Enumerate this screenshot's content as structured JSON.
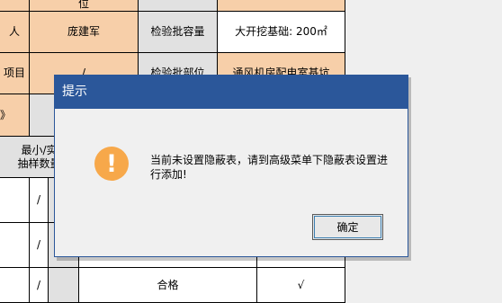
{
  "table": {
    "row0": {
      "c1": "位"
    },
    "row1": {
      "c0": "人",
      "c1": "庞建军",
      "c2": "检验批容量",
      "c3": "大开挖基础: 200㎡"
    },
    "row2": {
      "c0": "项目",
      "c1": "/",
      "c2": "检验批部位",
      "c3": "通风机房配电室基坑"
    },
    "row3": {
      "c0": "》"
    },
    "header": {
      "line1": "最小/实",
      "line2": "抽样数量"
    },
    "rows": [
      {
        "c1": "/",
        "c3": "",
        "c4": ""
      },
      {
        "c1": "/",
        "c3": "",
        "c4": ""
      },
      {
        "c1": "/",
        "c3": "合格",
        "c4": "√"
      }
    ]
  },
  "dialog": {
    "title": "提示",
    "icon": "exclamation-icon",
    "message": "当前未设置隐蔽表，请到高级菜单下隐蔽表设置进行添加!",
    "ok_label": "确定"
  },
  "colors": {
    "titlebar": "#2b579a",
    "cell_peach": "#f7cfa9",
    "icon_orange": "#f7a84a"
  }
}
